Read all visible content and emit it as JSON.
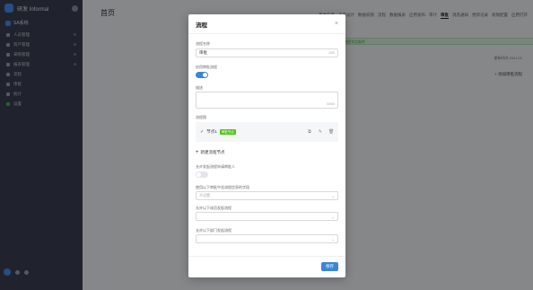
{
  "app": {
    "name": "研发 Informal",
    "workspace": "SA系统",
    "sidebar_items": [
      {
        "label": "人员管理"
      },
      {
        "label": "资产管理"
      },
      {
        "label": "采购管理"
      },
      {
        "label": "报表管理"
      },
      {
        "label": "流程"
      },
      {
        "label": "审批"
      },
      {
        "label": "统计"
      },
      {
        "label": "设置"
      }
    ]
  },
  "page": {
    "title": "首页",
    "tabs": [
      {
        "label": "基本信息",
        "active": false
      },
      {
        "label": "表单设计",
        "active": false
      },
      {
        "label": "数据权限",
        "active": false
      },
      {
        "label": "流程",
        "active": false
      },
      {
        "label": "数据报表",
        "active": false
      },
      {
        "label": "应用发布",
        "active": false
      },
      {
        "label": "审计",
        "active": false
      },
      {
        "label": "审批",
        "active": true
      },
      {
        "label": "消息通知",
        "active": false
      },
      {
        "label": "更新记录",
        "active": false
      },
      {
        "label": "权限配置",
        "active": false
      },
      {
        "label": "应用打开",
        "active": false
      }
    ],
    "notice": "流程配置已完成，请保存后生效，请注意审批流程节点条件",
    "right_link": "更新时间 2021.01",
    "add_link": "+ 添加审批流程"
  },
  "modal": {
    "title": "流程",
    "close": "×",
    "name_label": "流程名称",
    "name_value": "审批",
    "name_count": "2/50",
    "enable_label": "启用审批流程",
    "enable_on": true,
    "desc_label": "描述",
    "desc_count": "0/500",
    "nodes_label": "流程图",
    "node": {
      "chevron": "✓",
      "name": "节点1",
      "tag": "审批节点"
    },
    "node_actions": [
      "⧉",
      "✎",
      "🗑"
    ],
    "add_node": "新建流程节点",
    "allow_label": "允许发起流程申请审批人",
    "allow_on": false,
    "rule1_label": "使用以下审批中含流程信息的字段",
    "rule1_placeholder": "不设置",
    "rule2_label": "允许以下成员发起流程",
    "rule2_placeholder": "",
    "rule3_label": "允许以下部门发起流程",
    "rule3_placeholder": "",
    "save": "保存"
  }
}
